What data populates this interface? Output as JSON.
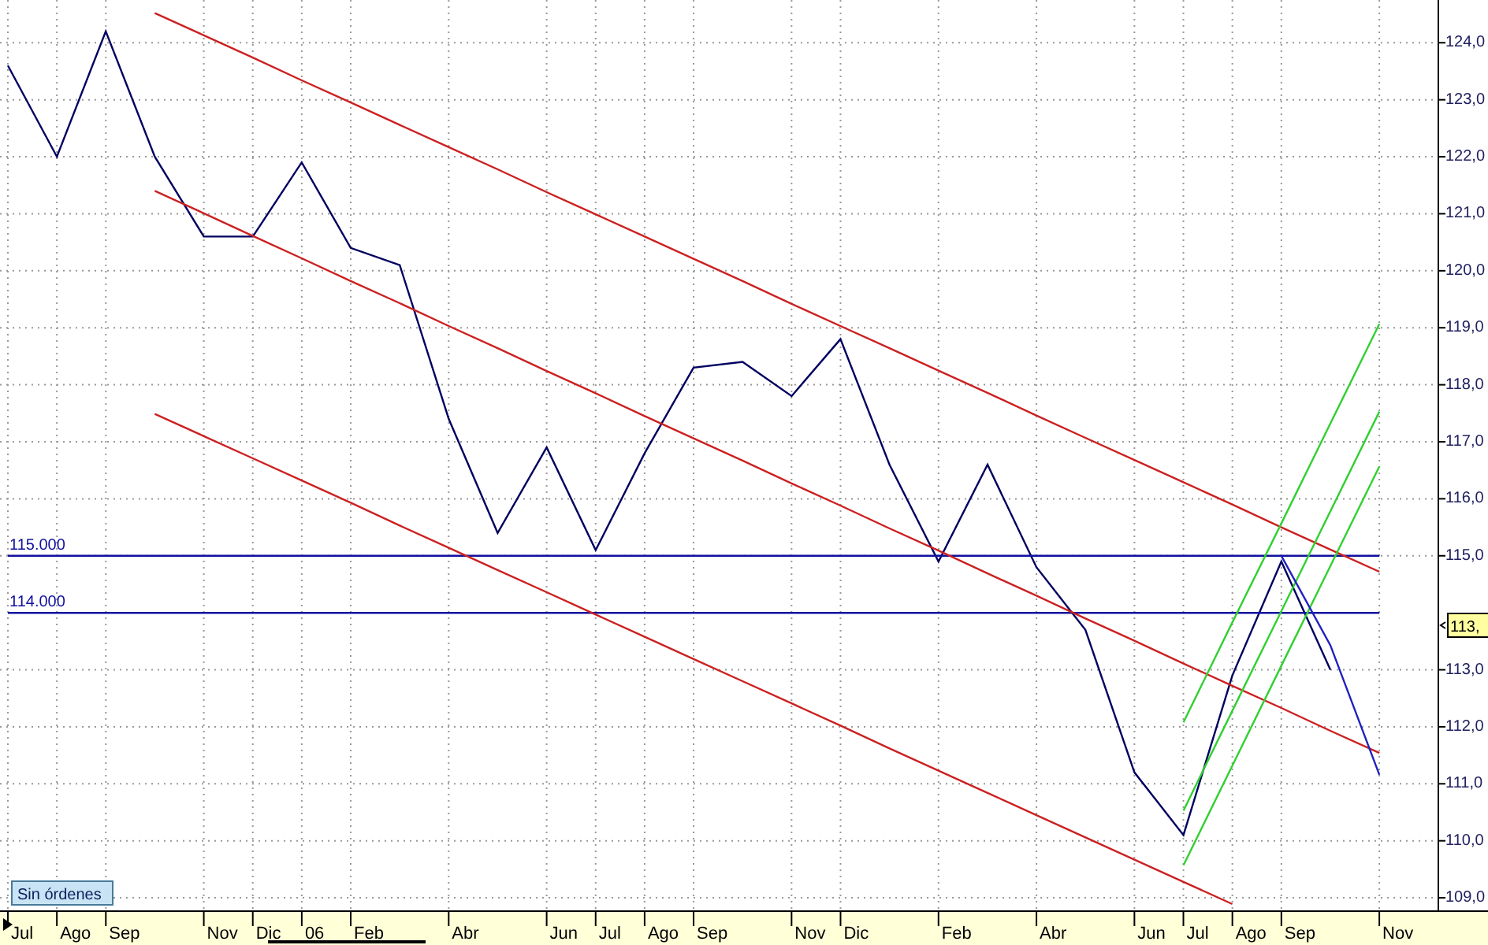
{
  "chart_data": {
    "type": "line",
    "categories": [
      "Jul",
      "Ago",
      "Sep",
      null,
      "Nov",
      "Dic",
      "06",
      "Feb",
      null,
      "Abr",
      null,
      "Jun",
      "Jul",
      "Ago",
      "Sep",
      null,
      "Nov",
      "Dic",
      null,
      "Feb",
      null,
      "Abr",
      null,
      "Jun",
      "Jul",
      "Ago",
      "Sep",
      null,
      "Nov"
    ],
    "series": [
      {
        "color": "#000060",
        "values": [
          123.6,
          122.0,
          124.2,
          122.0,
          120.6,
          120.6,
          121.9,
          120.4,
          120.1,
          117.4,
          115.4,
          116.9,
          115.1,
          116.8,
          118.3,
          118.4,
          117.8,
          118.8,
          116.6,
          114.9,
          116.6,
          114.8,
          113.7,
          111.2,
          110.1,
          112.9,
          114.9,
          113.0,
          null
        ]
      },
      {
        "name": "115.000",
        "color": "#1010a0",
        "values": [
          115,
          115,
          115,
          115,
          115,
          115,
          115,
          115,
          115,
          115,
          115,
          115,
          115,
          115,
          115,
          115,
          115,
          115,
          115,
          115,
          115,
          115,
          115,
          115,
          115,
          115,
          115,
          115,
          115
        ]
      },
      {
        "name": "114.000",
        "color": "#1010a0",
        "values": [
          114,
          114,
          114,
          114,
          114,
          114,
          114,
          114,
          114,
          114,
          114,
          114,
          114,
          114,
          114,
          114,
          114,
          114,
          114,
          114,
          114,
          114,
          114,
          114,
          114,
          114,
          114,
          114,
          114
        ]
      },
      {
        "color": "#cc2020",
        "values": [
          null,
          null,
          null,
          124.52,
          124.13,
          123.74,
          123.34,
          122.95,
          122.56,
          122.17,
          121.78,
          121.38,
          120.99,
          120.6,
          120.21,
          119.82,
          119.42,
          119.03,
          118.64,
          118.25,
          117.86,
          117.46,
          117.07,
          116.68,
          116.29,
          115.9,
          115.5,
          115.11,
          114.72
        ]
      },
      {
        "color": "#cc2020",
        "values": [
          null,
          null,
          null,
          121.4,
          121.01,
          120.61,
          120.22,
          119.82,
          119.43,
          119.03,
          118.64,
          118.24,
          117.85,
          117.45,
          117.06,
          116.67,
          116.27,
          115.88,
          115.48,
          115.09,
          114.69,
          114.3,
          113.9,
          113.51,
          113.11,
          112.72,
          112.33,
          111.93,
          111.54
        ]
      },
      {
        "color": "#cc2020",
        "values": [
          null,
          null,
          null,
          117.49,
          117.1,
          116.71,
          116.32,
          115.93,
          115.53,
          115.14,
          114.75,
          114.36,
          113.97,
          113.58,
          113.19,
          112.8,
          112.41,
          112.02,
          111.62,
          111.23,
          110.84,
          110.45,
          110.06,
          109.67,
          109.28,
          108.89,
          null,
          null,
          null
        ]
      },
      {
        "color": "#30d030",
        "values": [
          null,
          null,
          null,
          null,
          null,
          null,
          null,
          null,
          null,
          null,
          null,
          null,
          null,
          null,
          null,
          null,
          null,
          null,
          null,
          null,
          null,
          null,
          null,
          null,
          112.08,
          113.83,
          115.57,
          117.32,
          119.07
        ]
      },
      {
        "color": "#30d030",
        "values": [
          null,
          null,
          null,
          null,
          null,
          null,
          null,
          null,
          null,
          null,
          null,
          null,
          null,
          null,
          null,
          null,
          null,
          null,
          null,
          null,
          null,
          null,
          null,
          null,
          110.53,
          112.28,
          114.03,
          115.78,
          117.53
        ]
      },
      {
        "color": "#30d030",
        "values": [
          null,
          null,
          null,
          null,
          null,
          null,
          null,
          null,
          null,
          null,
          null,
          null,
          null,
          null,
          null,
          null,
          null,
          null,
          null,
          null,
          null,
          null,
          null,
          null,
          109.57,
          111.32,
          113.07,
          114.82,
          116.57
        ]
      },
      {
        "color": "#2020c0",
        "values": [
          null,
          null,
          null,
          null,
          null,
          null,
          null,
          null,
          null,
          null,
          null,
          null,
          null,
          null,
          null,
          null,
          null,
          null,
          null,
          null,
          null,
          null,
          null,
          null,
          null,
          null,
          115.0,
          113.43,
          111.16
        ]
      }
    ],
    "grid": true,
    "ylim": [
      108.78,
      124.75
    ],
    "yticks": [
      {
        "value": 124,
        "label": "124,0"
      },
      {
        "value": 123,
        "label": "123,0"
      },
      {
        "value": 122,
        "label": "122,0"
      },
      {
        "value": 121,
        "label": "121,0"
      },
      {
        "value": 120,
        "label": "120,0"
      },
      {
        "value": 119,
        "label": "119,0"
      },
      {
        "value": 118,
        "label": "118,0"
      },
      {
        "value": 117,
        "label": "117,0"
      },
      {
        "value": 116,
        "label": "116,0"
      },
      {
        "value": 115,
        "label": "115,0"
      },
      {
        "value": 113,
        "label": "113,0"
      },
      {
        "value": 112,
        "label": "112,0"
      },
      {
        "value": 111,
        "label": "111,0"
      },
      {
        "value": 110,
        "label": "110,0"
      },
      {
        "value": 109,
        "label": "109,0"
      }
    ]
  },
  "price_tag": "113,",
  "orders_badge": "Sin órdenes"
}
